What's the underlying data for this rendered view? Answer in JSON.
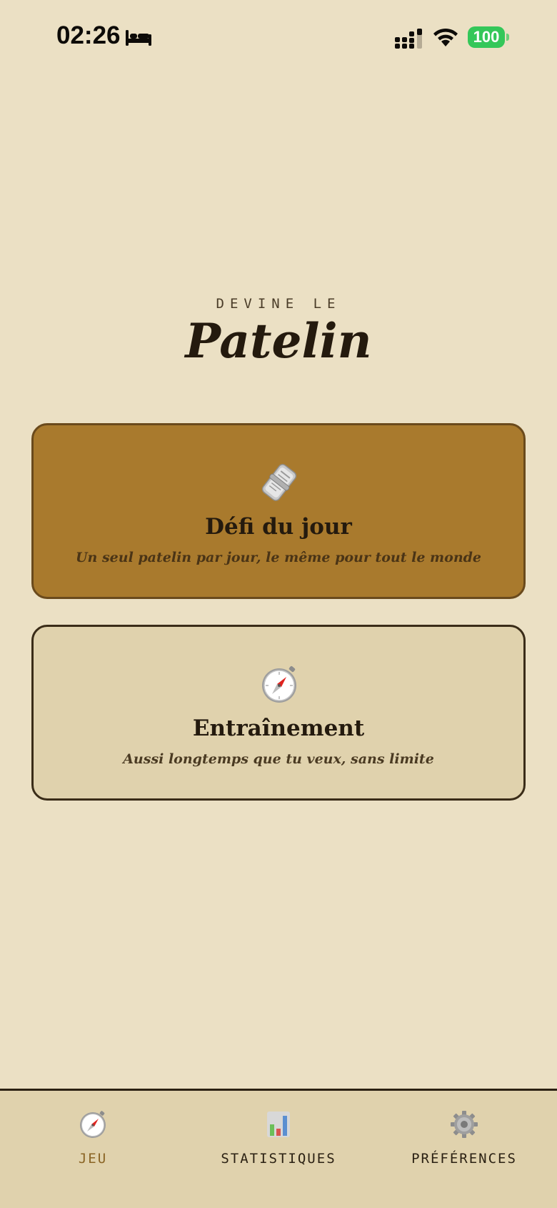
{
  "status_bar": {
    "time": "02:26",
    "battery_level": "100",
    "icons": [
      "bed-icon",
      "signal-icon",
      "wifi-icon",
      "battery-icon"
    ]
  },
  "header": {
    "kicker": "DEVINE LE",
    "title": "Patelin"
  },
  "modes": [
    {
      "icon": "newspaper-icon",
      "title": "Défi du jour",
      "subtitle": "Un seul patelin par jour, le même pour tout le monde",
      "selected": true
    },
    {
      "icon": "compass-icon",
      "title": "Entraînement",
      "subtitle": "Aussi longtemps que tu veux, sans limite",
      "selected": false
    }
  ],
  "tab_bar": {
    "tabs": [
      {
        "icon": "compass-icon",
        "label": "JEU",
        "active": true
      },
      {
        "icon": "bar-chart-icon",
        "label": "STATISTIQUES",
        "active": false
      },
      {
        "icon": "gear-icon",
        "label": "PRÉFÉRENCES",
        "active": false
      }
    ]
  },
  "colors": {
    "background": "#ebe0c4",
    "card_daily": "#a97a2d",
    "card_training": "#e0d2ad",
    "text_dark": "#241a0e",
    "active_tab": "#8a6424",
    "battery": "#34c759"
  }
}
